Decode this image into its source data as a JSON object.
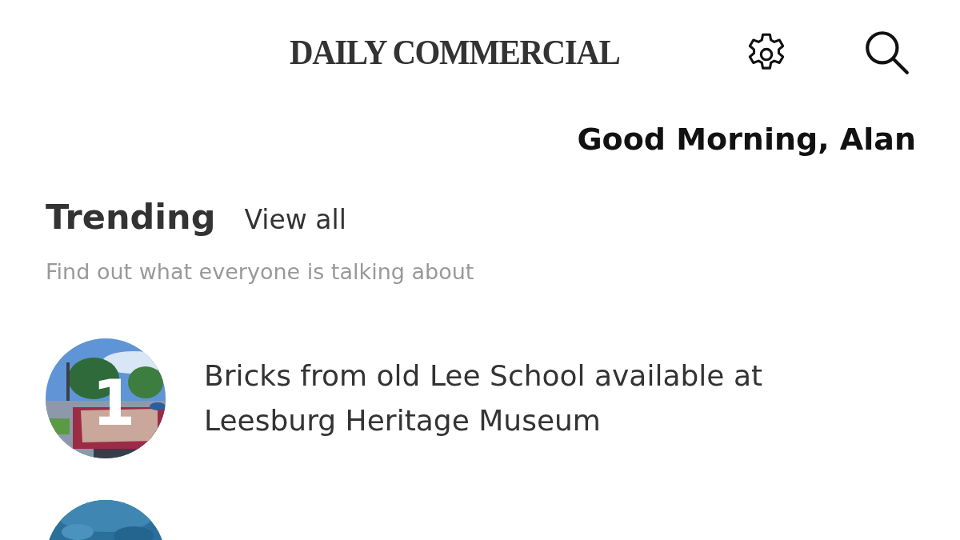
{
  "header": {
    "logo": "DAILY COMMERCIAL"
  },
  "greeting": "Good Morning, Alan",
  "trending": {
    "title": "Trending",
    "view_all": "View all",
    "subtitle": "Find out what everyone is talking about",
    "items": [
      {
        "rank": "1",
        "title": "Bricks from old Lee School available at Leesburg Heritage Museum",
        "image": {
          "kind": "picture"
        }
      },
      {
        "image": {
          "kind": "picture"
        }
      }
    ]
  }
}
